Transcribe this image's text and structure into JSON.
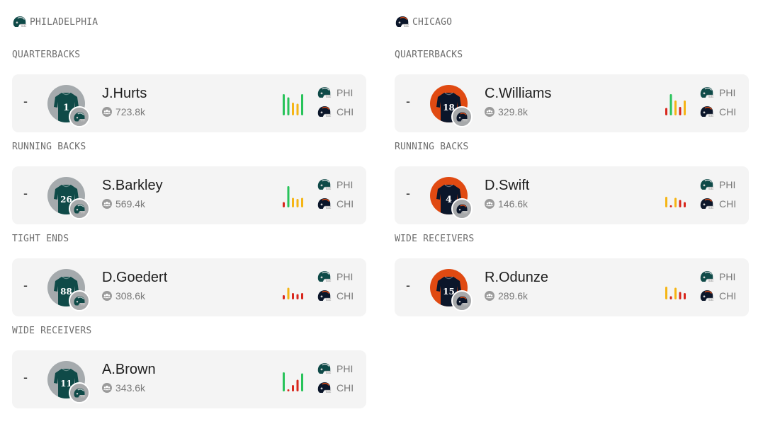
{
  "colors": {
    "eagles_green": "#0f4a48",
    "bears_navy": "#0b162a",
    "bears_orange": "#e04a12",
    "avatar_gray": "#a5aaad",
    "bar_green": "#28c35a",
    "bar_yellow": "#f5b515",
    "bar_red": "#d8261c"
  },
  "teams": [
    {
      "name": "PHILADELPHIA",
      "icon": "eagles-helmet-icon",
      "sections": [
        {
          "title": "QUARTERBACKS",
          "players": [
            {
              "rank": "-",
              "name": "J.Hurts",
              "number": "1",
              "followers": "723.8k",
              "bars": [
                [
                  "g",
                  1
                ],
                [
                  "g",
                  0.85
                ],
                [
                  "y",
                  0.6
                ],
                [
                  "y",
                  0.55
                ],
                [
                  "g",
                  1
                ]
              ],
              "matchup": [
                "PHI",
                "CHI"
              ]
            }
          ]
        },
        {
          "title": "RUNNING BACKS",
          "players": [
            {
              "rank": "-",
              "name": "S.Barkley",
              "number": "26",
              "followers": "569.4k",
              "bars": [
                [
                  "r",
                  0.25
                ],
                [
                  "g",
                  1
                ],
                [
                  "y",
                  0.45
                ],
                [
                  "y",
                  0.4
                ],
                [
                  "y",
                  0.45
                ]
              ],
              "matchup": [
                "PHI",
                "CHI"
              ]
            }
          ]
        },
        {
          "title": "TIGHT ENDS",
          "players": [
            {
              "rank": "-",
              "name": "D.Goedert",
              "number": "88",
              "followers": "308.6k",
              "bars": [
                [
                  "r",
                  0.2
                ],
                [
                  "y",
                  0.55
                ],
                [
                  "r",
                  0.3
                ],
                [
                  "r",
                  0.25
                ],
                [
                  "r",
                  0.3
                ]
              ],
              "matchup": [
                "PHI",
                "CHI"
              ]
            }
          ]
        },
        {
          "title": "WIDE RECEIVERS",
          "players": [
            {
              "rank": "-",
              "name": "A.Brown",
              "number": "11",
              "followers": "343.6k",
              "bars": [
                [
                  "g",
                  0.9
                ],
                [
                  "r",
                  0.1
                ],
                [
                  "r",
                  0.3
                ],
                [
                  "r",
                  0.55
                ],
                [
                  "g",
                  0.85
                ]
              ],
              "matchup": [
                "PHI",
                "CHI"
              ]
            }
          ]
        }
      ]
    },
    {
      "name": "CHICAGO",
      "icon": "bears-helmet-icon",
      "sections": [
        {
          "title": "QUARTERBACKS",
          "players": [
            {
              "rank": "-",
              "name": "C.Williams",
              "number": "18",
              "followers": "329.8k",
              "bars": [
                [
                  "r",
                  0.35
                ],
                [
                  "g",
                  1
                ],
                [
                  "y",
                  0.7
                ],
                [
                  "r",
                  0.4
                ],
                [
                  "y",
                  0.7
                ]
              ],
              "matchup": [
                "PHI",
                "CHI"
              ]
            }
          ]
        },
        {
          "title": "RUNNING BACKS",
          "players": [
            {
              "rank": "-",
              "name": "D.Swift",
              "number": "4",
              "followers": "146.6k",
              "bars": [
                [
                  "y",
                  0.5
                ],
                [
                  "r",
                  0.1
                ],
                [
                  "y",
                  0.45
                ],
                [
                  "r",
                  0.35
                ],
                [
                  "r",
                  0.25
                ]
              ],
              "matchup": [
                "PHI",
                "CHI"
              ]
            }
          ]
        },
        {
          "title": "WIDE RECEIVERS",
          "players": [
            {
              "rank": "-",
              "name": "R.Odunze",
              "number": "15",
              "followers": "289.6k",
              "bars": [
                [
                  "y",
                  0.6
                ],
                [
                  "r",
                  0.15
                ],
                [
                  "y",
                  0.55
                ],
                [
                  "r",
                  0.35
                ],
                [
                  "r",
                  0.3
                ]
              ],
              "matchup": [
                "PHI",
                "CHI"
              ]
            }
          ]
        }
      ]
    }
  ]
}
